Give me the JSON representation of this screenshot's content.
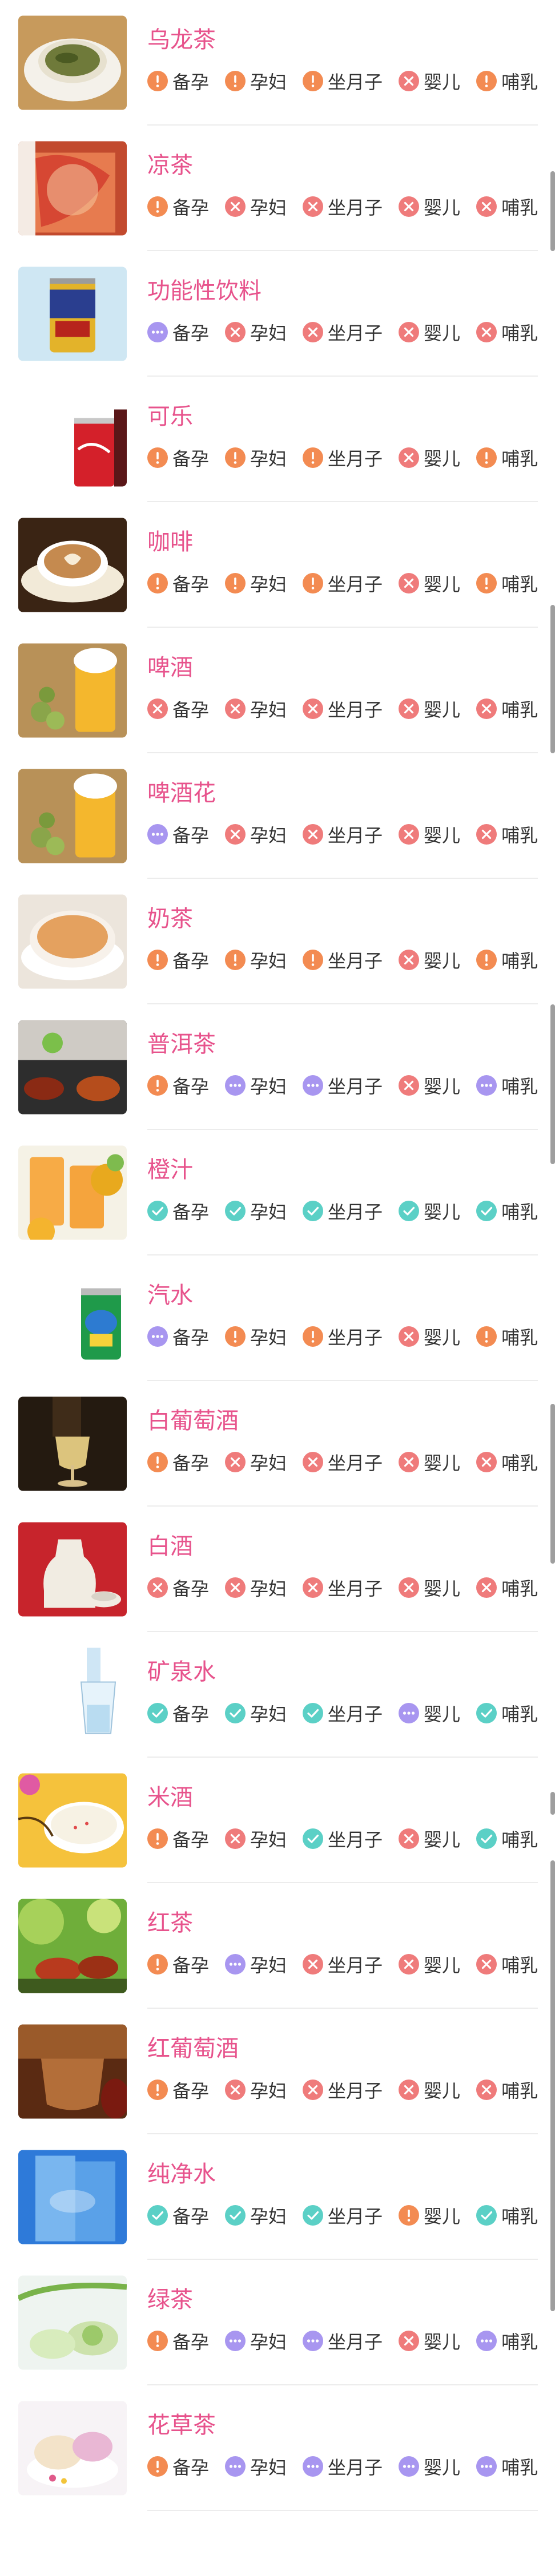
{
  "legend": {
    "caution": {
      "color": "#f38b52",
      "icon": "exclamation-icon"
    },
    "forbidden": {
      "color": "#ef7b7b",
      "icon": "cross-icon"
    },
    "moderate": {
      "color": "#a896f0",
      "icon": "ellipsis-icon"
    },
    "allowed": {
      "color": "#5bd0c6",
      "icon": "check-icon"
    }
  },
  "items": [
    {
      "name": "乌龙茶",
      "icon": "oolong-tea-image",
      "tags": [
        {
          "label": "备孕",
          "status": "caution"
        },
        {
          "label": "孕妇",
          "status": "caution"
        },
        {
          "label": "坐月子",
          "status": "caution"
        },
        {
          "label": "婴儿",
          "status": "forbidden"
        },
        {
          "label": "哺乳",
          "status": "caution"
        }
      ]
    },
    {
      "name": "凉茶",
      "icon": "herbal-tea-image",
      "tags": [
        {
          "label": "备孕",
          "status": "caution"
        },
        {
          "label": "孕妇",
          "status": "forbidden"
        },
        {
          "label": "坐月子",
          "status": "forbidden"
        },
        {
          "label": "婴儿",
          "status": "forbidden"
        },
        {
          "label": "哺乳",
          "status": "forbidden"
        }
      ]
    },
    {
      "name": "功能性饮料",
      "icon": "energy-drink-image",
      "tags": [
        {
          "label": "备孕",
          "status": "moderate"
        },
        {
          "label": "孕妇",
          "status": "forbidden"
        },
        {
          "label": "坐月子",
          "status": "forbidden"
        },
        {
          "label": "婴儿",
          "status": "forbidden"
        },
        {
          "label": "哺乳",
          "status": "forbidden"
        }
      ]
    },
    {
      "name": "可乐",
      "icon": "cola-image",
      "tags": [
        {
          "label": "备孕",
          "status": "caution"
        },
        {
          "label": "孕妇",
          "status": "caution"
        },
        {
          "label": "坐月子",
          "status": "caution"
        },
        {
          "label": "婴儿",
          "status": "forbidden"
        },
        {
          "label": "哺乳",
          "status": "caution"
        }
      ]
    },
    {
      "name": "咖啡",
      "icon": "coffee-image",
      "tags": [
        {
          "label": "备孕",
          "status": "caution"
        },
        {
          "label": "孕妇",
          "status": "caution"
        },
        {
          "label": "坐月子",
          "status": "caution"
        },
        {
          "label": "婴儿",
          "status": "forbidden"
        },
        {
          "label": "哺乳",
          "status": "caution"
        }
      ]
    },
    {
      "name": "啤酒",
      "icon": "beer-image",
      "tags": [
        {
          "label": "备孕",
          "status": "forbidden"
        },
        {
          "label": "孕妇",
          "status": "forbidden"
        },
        {
          "label": "坐月子",
          "status": "forbidden"
        },
        {
          "label": "婴儿",
          "status": "forbidden"
        },
        {
          "label": "哺乳",
          "status": "forbidden"
        }
      ]
    },
    {
      "name": "啤酒花",
      "icon": "hops-image",
      "tags": [
        {
          "label": "备孕",
          "status": "moderate"
        },
        {
          "label": "孕妇",
          "status": "forbidden"
        },
        {
          "label": "坐月子",
          "status": "forbidden"
        },
        {
          "label": "婴儿",
          "status": "forbidden"
        },
        {
          "label": "哺乳",
          "status": "forbidden"
        }
      ]
    },
    {
      "name": "奶茶",
      "icon": "milk-tea-image",
      "tags": [
        {
          "label": "备孕",
          "status": "caution"
        },
        {
          "label": "孕妇",
          "status": "caution"
        },
        {
          "label": "坐月子",
          "status": "caution"
        },
        {
          "label": "婴儿",
          "status": "forbidden"
        },
        {
          "label": "哺乳",
          "status": "caution"
        }
      ]
    },
    {
      "name": "普洱茶",
      "icon": "puer-tea-image",
      "tags": [
        {
          "label": "备孕",
          "status": "caution"
        },
        {
          "label": "孕妇",
          "status": "moderate"
        },
        {
          "label": "坐月子",
          "status": "moderate"
        },
        {
          "label": "婴儿",
          "status": "forbidden"
        },
        {
          "label": "哺乳",
          "status": "moderate"
        }
      ]
    },
    {
      "name": "橙汁",
      "icon": "orange-juice-image",
      "tags": [
        {
          "label": "备孕",
          "status": "allowed"
        },
        {
          "label": "孕妇",
          "status": "allowed"
        },
        {
          "label": "坐月子",
          "status": "allowed"
        },
        {
          "label": "婴儿",
          "status": "allowed"
        },
        {
          "label": "哺乳",
          "status": "allowed"
        }
      ]
    },
    {
      "name": "汽水",
      "icon": "soda-image",
      "tags": [
        {
          "label": "备孕",
          "status": "moderate"
        },
        {
          "label": "孕妇",
          "status": "caution"
        },
        {
          "label": "坐月子",
          "status": "caution"
        },
        {
          "label": "婴儿",
          "status": "forbidden"
        },
        {
          "label": "哺乳",
          "status": "caution"
        }
      ]
    },
    {
      "name": "白葡萄酒",
      "icon": "white-wine-image",
      "tags": [
        {
          "label": "备孕",
          "status": "caution"
        },
        {
          "label": "孕妇",
          "status": "forbidden"
        },
        {
          "label": "坐月子",
          "status": "forbidden"
        },
        {
          "label": "婴儿",
          "status": "forbidden"
        },
        {
          "label": "哺乳",
          "status": "forbidden"
        }
      ]
    },
    {
      "name": "白酒",
      "icon": "liquor-image",
      "tags": [
        {
          "label": "备孕",
          "status": "forbidden"
        },
        {
          "label": "孕妇",
          "status": "forbidden"
        },
        {
          "label": "坐月子",
          "status": "forbidden"
        },
        {
          "label": "婴儿",
          "status": "forbidden"
        },
        {
          "label": "哺乳",
          "status": "forbidden"
        }
      ]
    },
    {
      "name": "矿泉水",
      "icon": "mineral-water-image",
      "tags": [
        {
          "label": "备孕",
          "status": "allowed"
        },
        {
          "label": "孕妇",
          "status": "allowed"
        },
        {
          "label": "坐月子",
          "status": "allowed"
        },
        {
          "label": "婴儿",
          "status": "moderate"
        },
        {
          "label": "哺乳",
          "status": "allowed"
        }
      ]
    },
    {
      "name": "米酒",
      "icon": "rice-wine-image",
      "tags": [
        {
          "label": "备孕",
          "status": "caution"
        },
        {
          "label": "孕妇",
          "status": "forbidden"
        },
        {
          "label": "坐月子",
          "status": "allowed"
        },
        {
          "label": "婴儿",
          "status": "forbidden"
        },
        {
          "label": "哺乳",
          "status": "allowed"
        }
      ]
    },
    {
      "name": "红茶",
      "icon": "black-tea-image",
      "tags": [
        {
          "label": "备孕",
          "status": "caution"
        },
        {
          "label": "孕妇",
          "status": "moderate"
        },
        {
          "label": "坐月子",
          "status": "forbidden"
        },
        {
          "label": "婴儿",
          "status": "forbidden"
        },
        {
          "label": "哺乳",
          "status": "forbidden"
        }
      ]
    },
    {
      "name": "红葡萄酒",
      "icon": "red-wine-image",
      "tags": [
        {
          "label": "备孕",
          "status": "caution"
        },
        {
          "label": "孕妇",
          "status": "forbidden"
        },
        {
          "label": "坐月子",
          "status": "forbidden"
        },
        {
          "label": "婴儿",
          "status": "forbidden"
        },
        {
          "label": "哺乳",
          "status": "forbidden"
        }
      ]
    },
    {
      "name": "纯净水",
      "icon": "purified-water-image",
      "tags": [
        {
          "label": "备孕",
          "status": "allowed"
        },
        {
          "label": "孕妇",
          "status": "allowed"
        },
        {
          "label": "坐月子",
          "status": "allowed"
        },
        {
          "label": "婴儿",
          "status": "caution"
        },
        {
          "label": "哺乳",
          "status": "allowed"
        }
      ]
    },
    {
      "name": "绿茶",
      "icon": "green-tea-image",
      "tags": [
        {
          "label": "备孕",
          "status": "caution"
        },
        {
          "label": "孕妇",
          "status": "moderate"
        },
        {
          "label": "坐月子",
          "status": "moderate"
        },
        {
          "label": "婴儿",
          "status": "forbidden"
        },
        {
          "label": "哺乳",
          "status": "moderate"
        }
      ]
    },
    {
      "name": "花草茶",
      "icon": "flower-tea-image",
      "tags": [
        {
          "label": "备孕",
          "status": "caution"
        },
        {
          "label": "孕妇",
          "status": "moderate"
        },
        {
          "label": "坐月子",
          "status": "moderate"
        },
        {
          "label": "婴儿",
          "status": "moderate"
        },
        {
          "label": "哺乳",
          "status": "moderate"
        }
      ]
    }
  ]
}
